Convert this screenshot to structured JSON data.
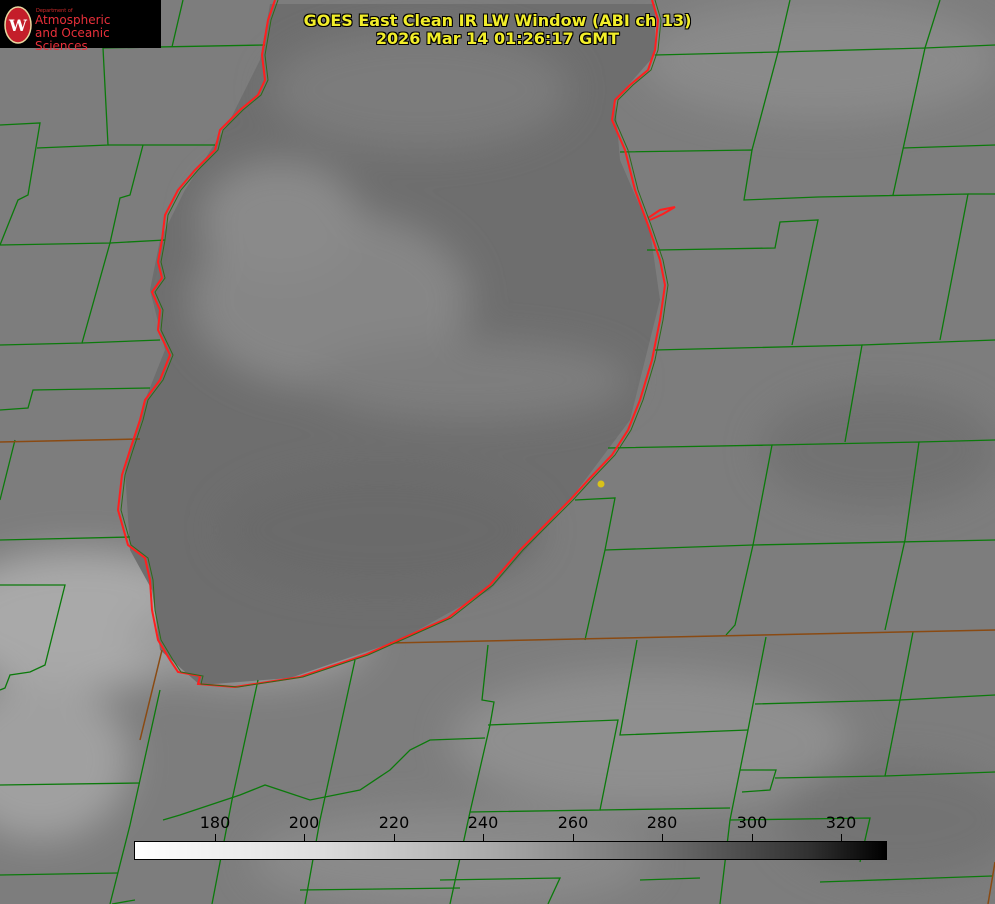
{
  "title": {
    "line1": "GOES East Clean IR LW Window (ABI ch 13)",
    "line2": "2026 Mar 14 01:26:17 GMT"
  },
  "logo": {
    "department": "Department of",
    "line1": "Atmospheric",
    "line2": "and Oceanic Sciences",
    "emblem": "W",
    "color": "#e8303a"
  },
  "colorbar": {
    "ticks": [
      "180",
      "200",
      "220",
      "240",
      "260",
      "280",
      "300",
      "320"
    ],
    "gradient_from": "#ffffff",
    "gradient_to": "#000000"
  },
  "map_colors": {
    "county_lines": "#0b7a0b",
    "state_lines": "#8a4a12",
    "coastline": "#ff2020",
    "station_marker": "#d9c21a"
  }
}
